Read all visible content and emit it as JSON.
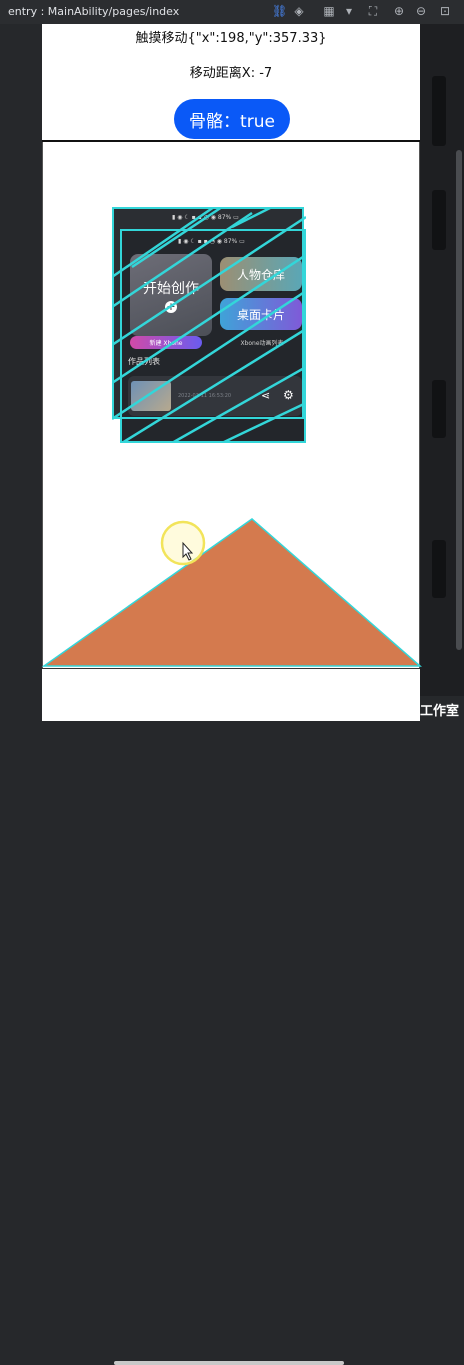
{
  "ide": {
    "path": "entry : MainAbility/pages/index",
    "icons": [
      "link-icon",
      "layers-icon",
      "grid-icon",
      "dropdown-icon",
      "frame-icon",
      "zoom-in-icon",
      "zoom-out-icon",
      "fit-icon"
    ]
  },
  "header": {
    "touch_move": "触摸移动{\"x\":198,\"y\":357.33}",
    "move_distance": "移动距离X: -7",
    "skeleton_button": "骨骼：true"
  },
  "card": {
    "create_tile": "开始创作",
    "warehouse_tile": "人物仓库",
    "desktop_tile": "桌面卡片",
    "new_pill": "新建 Xbone",
    "list_pill": "Xbone动画列表",
    "works_title": "作品列表",
    "work_date": "2022-03-11 16:53:20"
  },
  "watermark": "工作室",
  "colors": {
    "accent": "#0a59f7",
    "triangle_fill": "#d47a4e",
    "highlight": "#33d6d9"
  }
}
